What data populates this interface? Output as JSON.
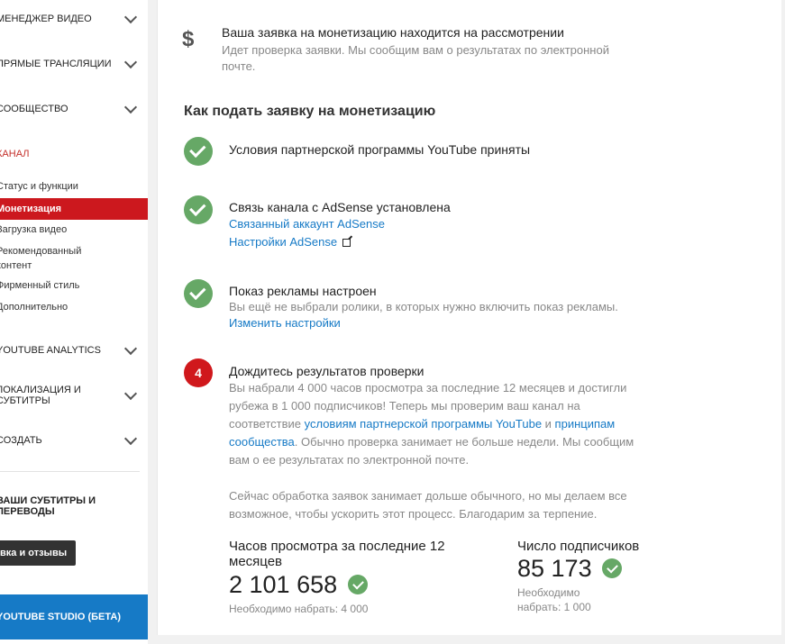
{
  "sidebar": {
    "sections": [
      {
        "label": "Менеджер видео"
      },
      {
        "label": "Прямые трансляции"
      },
      {
        "label": "Сообщество"
      }
    ],
    "channel_label": "Канал",
    "channel_items": [
      {
        "label": "Статус и функции"
      },
      {
        "label": "Монетизация"
      },
      {
        "label": "Загрузка видео"
      },
      {
        "label": "Рекомендованный",
        "label2": "контент"
      },
      {
        "label": "Фирменный стиль"
      },
      {
        "label": "Дополнительно"
      }
    ],
    "analytics": "YouTube Analytics",
    "localization_1": "Локализация и",
    "localization_2": "субтитры",
    "create": "Создать",
    "subtitles_1": "Ваши субтитры и",
    "subtitles_2": "переводы",
    "feedback": "вка и отзывы",
    "studio": "YouTube Studio (бета)"
  },
  "review": {
    "icon": "dollar-icon",
    "title": "Ваша заявка на монетизацию находится на рассмотрении",
    "desc": "Идет проверка заявки. Мы сообщим вам о результатах по электронной почте."
  },
  "howto_heading": "Как подать заявку на монетизацию",
  "steps": [
    {
      "title": "Условия партнерской программы YouTube приняты"
    },
    {
      "title": "Связь канала с AdSense установлена",
      "link1": "Связанный аккаунт AdSense",
      "link2": "Настройки AdSense"
    },
    {
      "title": "Показ рекламы настроен",
      "desc": "Вы ещё не выбрали ролики, в которых нужно включить показ рекламы.",
      "link": "Изменить настройки"
    },
    {
      "number": "4",
      "title": "Дождитесь результатов проверки",
      "desc_a": "Вы набрали 4 000 часов просмотра за последние 12 месяцев и достигли рубежа в 1 000 подписчиков! Теперь мы проверим ваш канал на соответствие ",
      "link_a": "условиям партнерской программы YouTube",
      "desc_b": " и ",
      "link_b": "принципам сообщества",
      "desc_c": ". Обычно проверка занимает не больше недели. Мы сообщим вам о ее результатах по электронной почте.",
      "note": "Сейчас обработка заявок занимает дольше обычного, но мы делаем все возможное, чтобы ускорить этот процесс. Благодарим за терпение."
    }
  ],
  "stats": {
    "hours": {
      "label": "Часов просмотра за последние 12 месяцев",
      "value": "2 101 658",
      "required": "Необходимо набрать: 4 000"
    },
    "subs": {
      "label": "Число подписчиков",
      "value": "85 173",
      "required": "Необходимо набрать: 1 000"
    }
  },
  "colors": {
    "accent_red": "#cc181e",
    "link_blue": "#167ac6",
    "success_green": "#66a866",
    "studio_blue": "#167ac6"
  }
}
